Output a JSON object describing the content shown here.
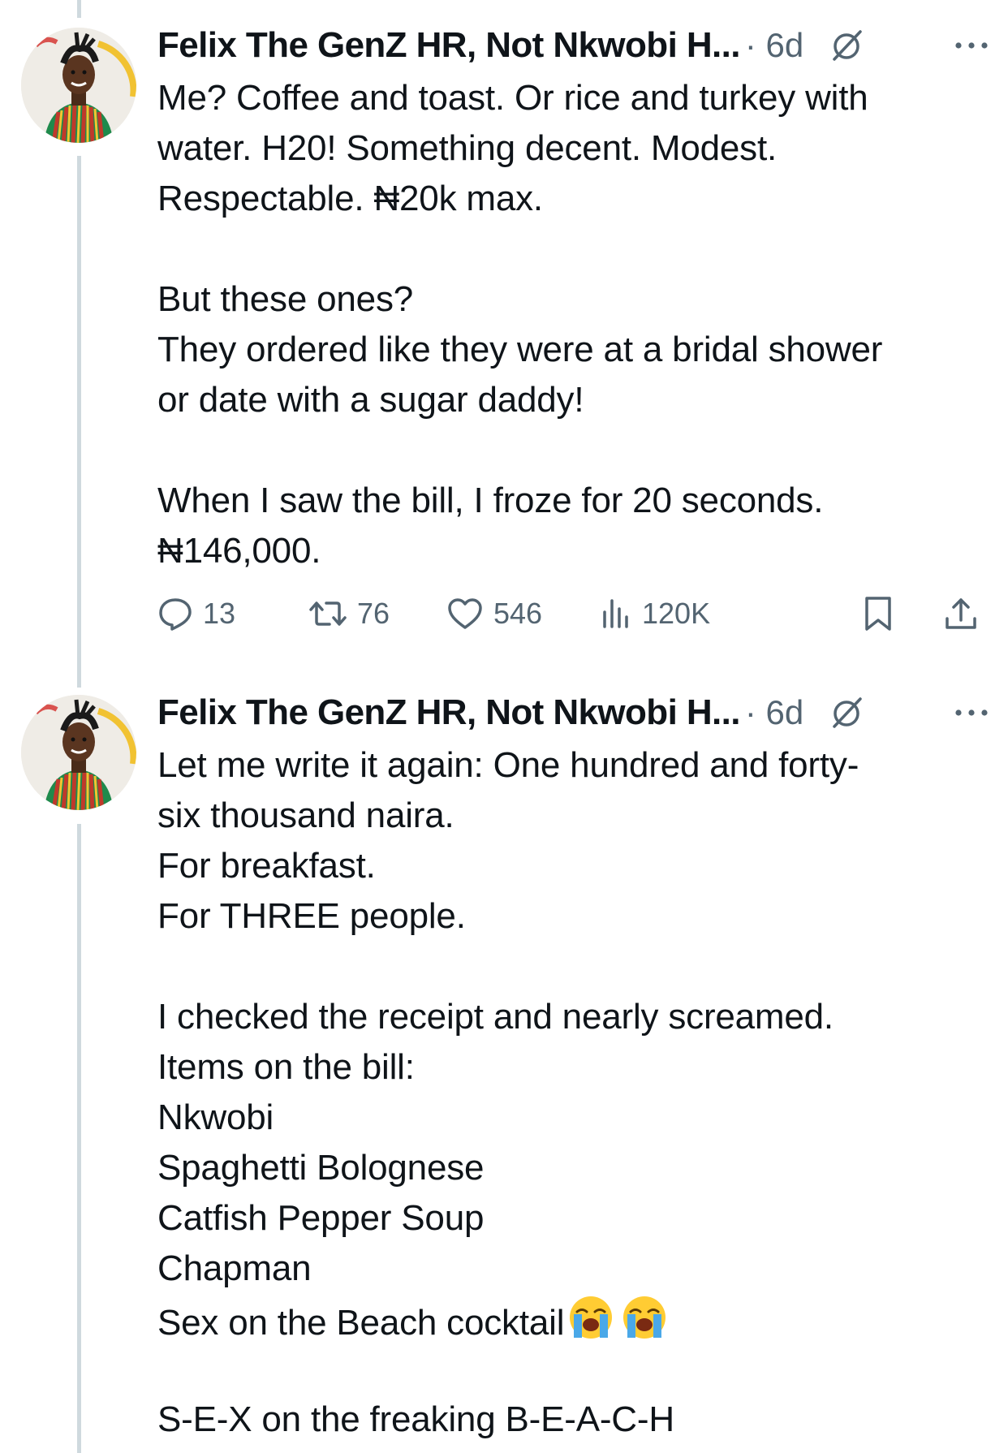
{
  "tweets": [
    {
      "author": "Felix The GenZ HR, Not Nkwobi H...",
      "meta": "· 6d",
      "lines": [
        "Me? Coffee and toast. Or rice and turkey with",
        "water. H20! Something decent. Modest.",
        "Respectable. ₦20k max.",
        "",
        "But these ones?",
        "They ordered like they were at a bridal shower",
        "or date with a sugar daddy!",
        "",
        "When I saw the bill, I froze for 20 seconds.",
        "₦146,000."
      ],
      "stats": {
        "replies": "13",
        "reposts": "76",
        "likes": "546",
        "views": "120K"
      }
    },
    {
      "author": "Felix The GenZ HR, Not Nkwobi H...",
      "meta": "· 6d",
      "lines": [
        "Let me write it again: One hundred and forty-",
        "six thousand naira.",
        "For breakfast.",
        "For THREE people.",
        "",
        "I checked the receipt and nearly screamed.",
        "Items on the bill:",
        "Nkwobi",
        "Spaghetti Bolognese",
        "Catfish Pepper Soup",
        "Chapman",
        "Sex on the Beach cocktail",
        "",
        "S-E-X on the freaking B-E-A-C-H"
      ],
      "emoji_after_line": 11,
      "emojis": [
        "loudly-crying-face",
        "loudly-crying-face"
      ]
    }
  ],
  "icons": {
    "reply": "speech-bubble-icon",
    "repost": "repost-arrows-icon",
    "like": "heart-icon",
    "views": "bar-chart-icon",
    "bookmark": "bookmark-icon",
    "share": "share-upload-icon",
    "grok": "grok-slash-circle-icon",
    "more": "more-dots-icon"
  },
  "colors": {
    "text": "#0f1419",
    "secondary": "#536471",
    "thread_line": "#cfd9de",
    "background": "#ffffff"
  }
}
